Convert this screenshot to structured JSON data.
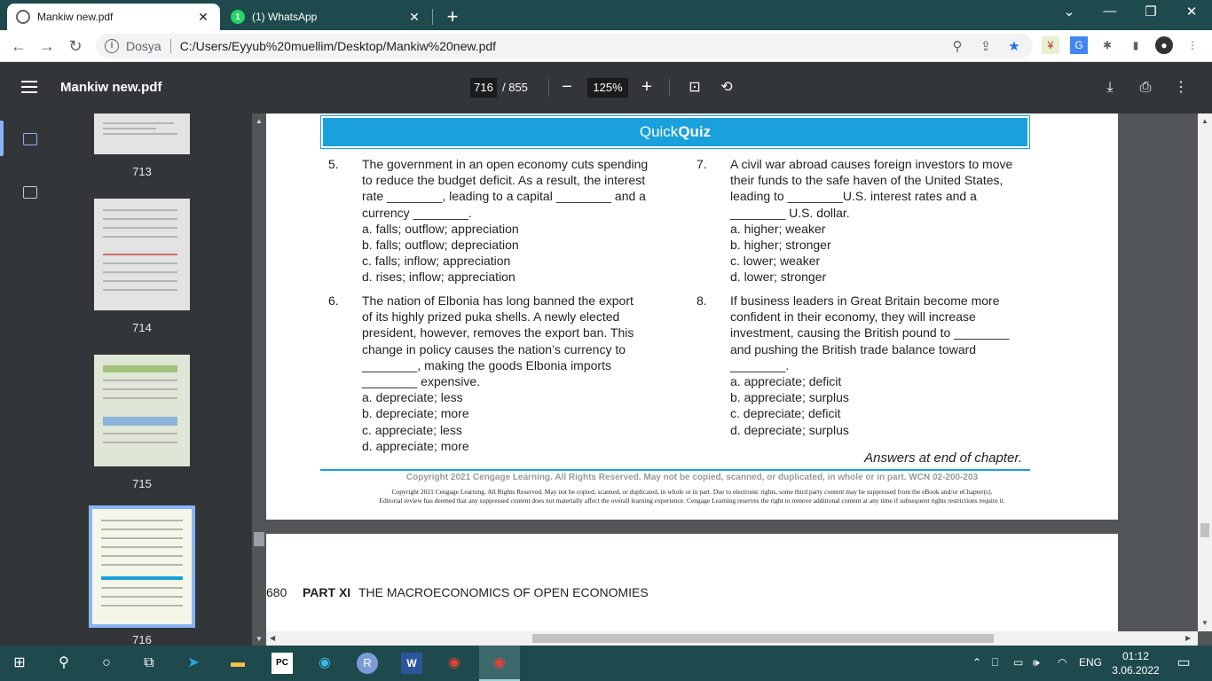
{
  "browser": {
    "tabs": [
      {
        "title": "Mankiw new.pdf",
        "icon": "globe-icon"
      },
      {
        "title": "(1) WhatsApp",
        "icon": "whatsapp-icon",
        "badge": "1"
      }
    ],
    "new_tab": "+",
    "address": {
      "scheme": "Dosya",
      "path": "C:/Users/Eyyub%20muellim/Desktop/Mankiw%20new.pdf"
    }
  },
  "pdf_toolbar": {
    "title": "Mankiw new.pdf",
    "current_page": "716",
    "total_pages": "/ 855",
    "zoom": "125%"
  },
  "sidebar": {
    "thumbnails": [
      {
        "label": "713"
      },
      {
        "label": "714"
      },
      {
        "label": "715"
      },
      {
        "label": "716",
        "selected": true
      }
    ]
  },
  "page": {
    "banner_light": "Quick",
    "banner_bold": "Quiz",
    "questions": [
      {
        "num": "5.",
        "stem": "The government in an open economy cuts spending\nto reduce the budget deficit. As a result, the interest\nrate ________, leading to a capital ________ and a\ncurrency ________.",
        "options": [
          "a. falls; outflow; appreciation",
          "b. falls; outflow; depreciation",
          "c. falls; inflow; appreciation",
          "d. rises; inflow; appreciation"
        ]
      },
      {
        "num": "6.",
        "stem": "The nation of Elbonia has long banned the export\nof its highly prized puka shells. A newly elected\npresident, however, removes the export ban. This\nchange in policy causes the nation’s currency to\n________, making the goods Elbonia imports\n________ expensive.",
        "options": [
          "a. depreciate; less",
          "b. depreciate; more",
          "c. appreciate; less",
          "d. appreciate; more"
        ]
      },
      {
        "num": "7.",
        "stem": "A civil war abroad causes foreign investors to move\ntheir funds to the safe haven of the United States,\nleading to ________U.S. interest rates and a\n________ U.S. dollar.",
        "options": [
          "a. higher; weaker",
          "b. higher; stronger",
          "c. lower; weaker",
          "d. lower; stronger"
        ]
      },
      {
        "num": "8.",
        "stem": "If business leaders in Great Britain become more\nconfident in their economy, they will increase\ninvestment, causing the British pound to ________\nand pushing the British trade balance toward\n________.",
        "options": [
          "a. appreciate; deficit",
          "b. appreciate; surplus",
          "c. depreciate; deficit",
          "d. depreciate; surplus"
        ]
      }
    ],
    "answers_note": "Answers at end of chapter.",
    "copyright_line": "Copyright 2021 Cengage Learning. All Rights Reserved. May not be copied, scanned, or duplicated, in whole or in part.  WCN 02-200-203",
    "copyright_small_1": "Copyright 2021 Cengage Learning. All Rights Reserved. May not be copied, scanned, or duplicated, in whole or in part. Due to electronic rights, some third party content may be suppressed from the eBook and/or eChapter(s).",
    "copyright_small_2": "Editorial review has deemed that any suppressed content does not materially affect the overall learning experience. Cengage Learning reserves the right to remove additional content at any time if subsequent rights restrictions require it."
  },
  "page2": {
    "page_number": "680",
    "part": "PART XI",
    "part_title": "THE MACROECONOMICS OF OPEN ECONOMIES"
  },
  "taskbar": {
    "language": "ENG",
    "time": "01:12",
    "date": "3.06.2022"
  }
}
